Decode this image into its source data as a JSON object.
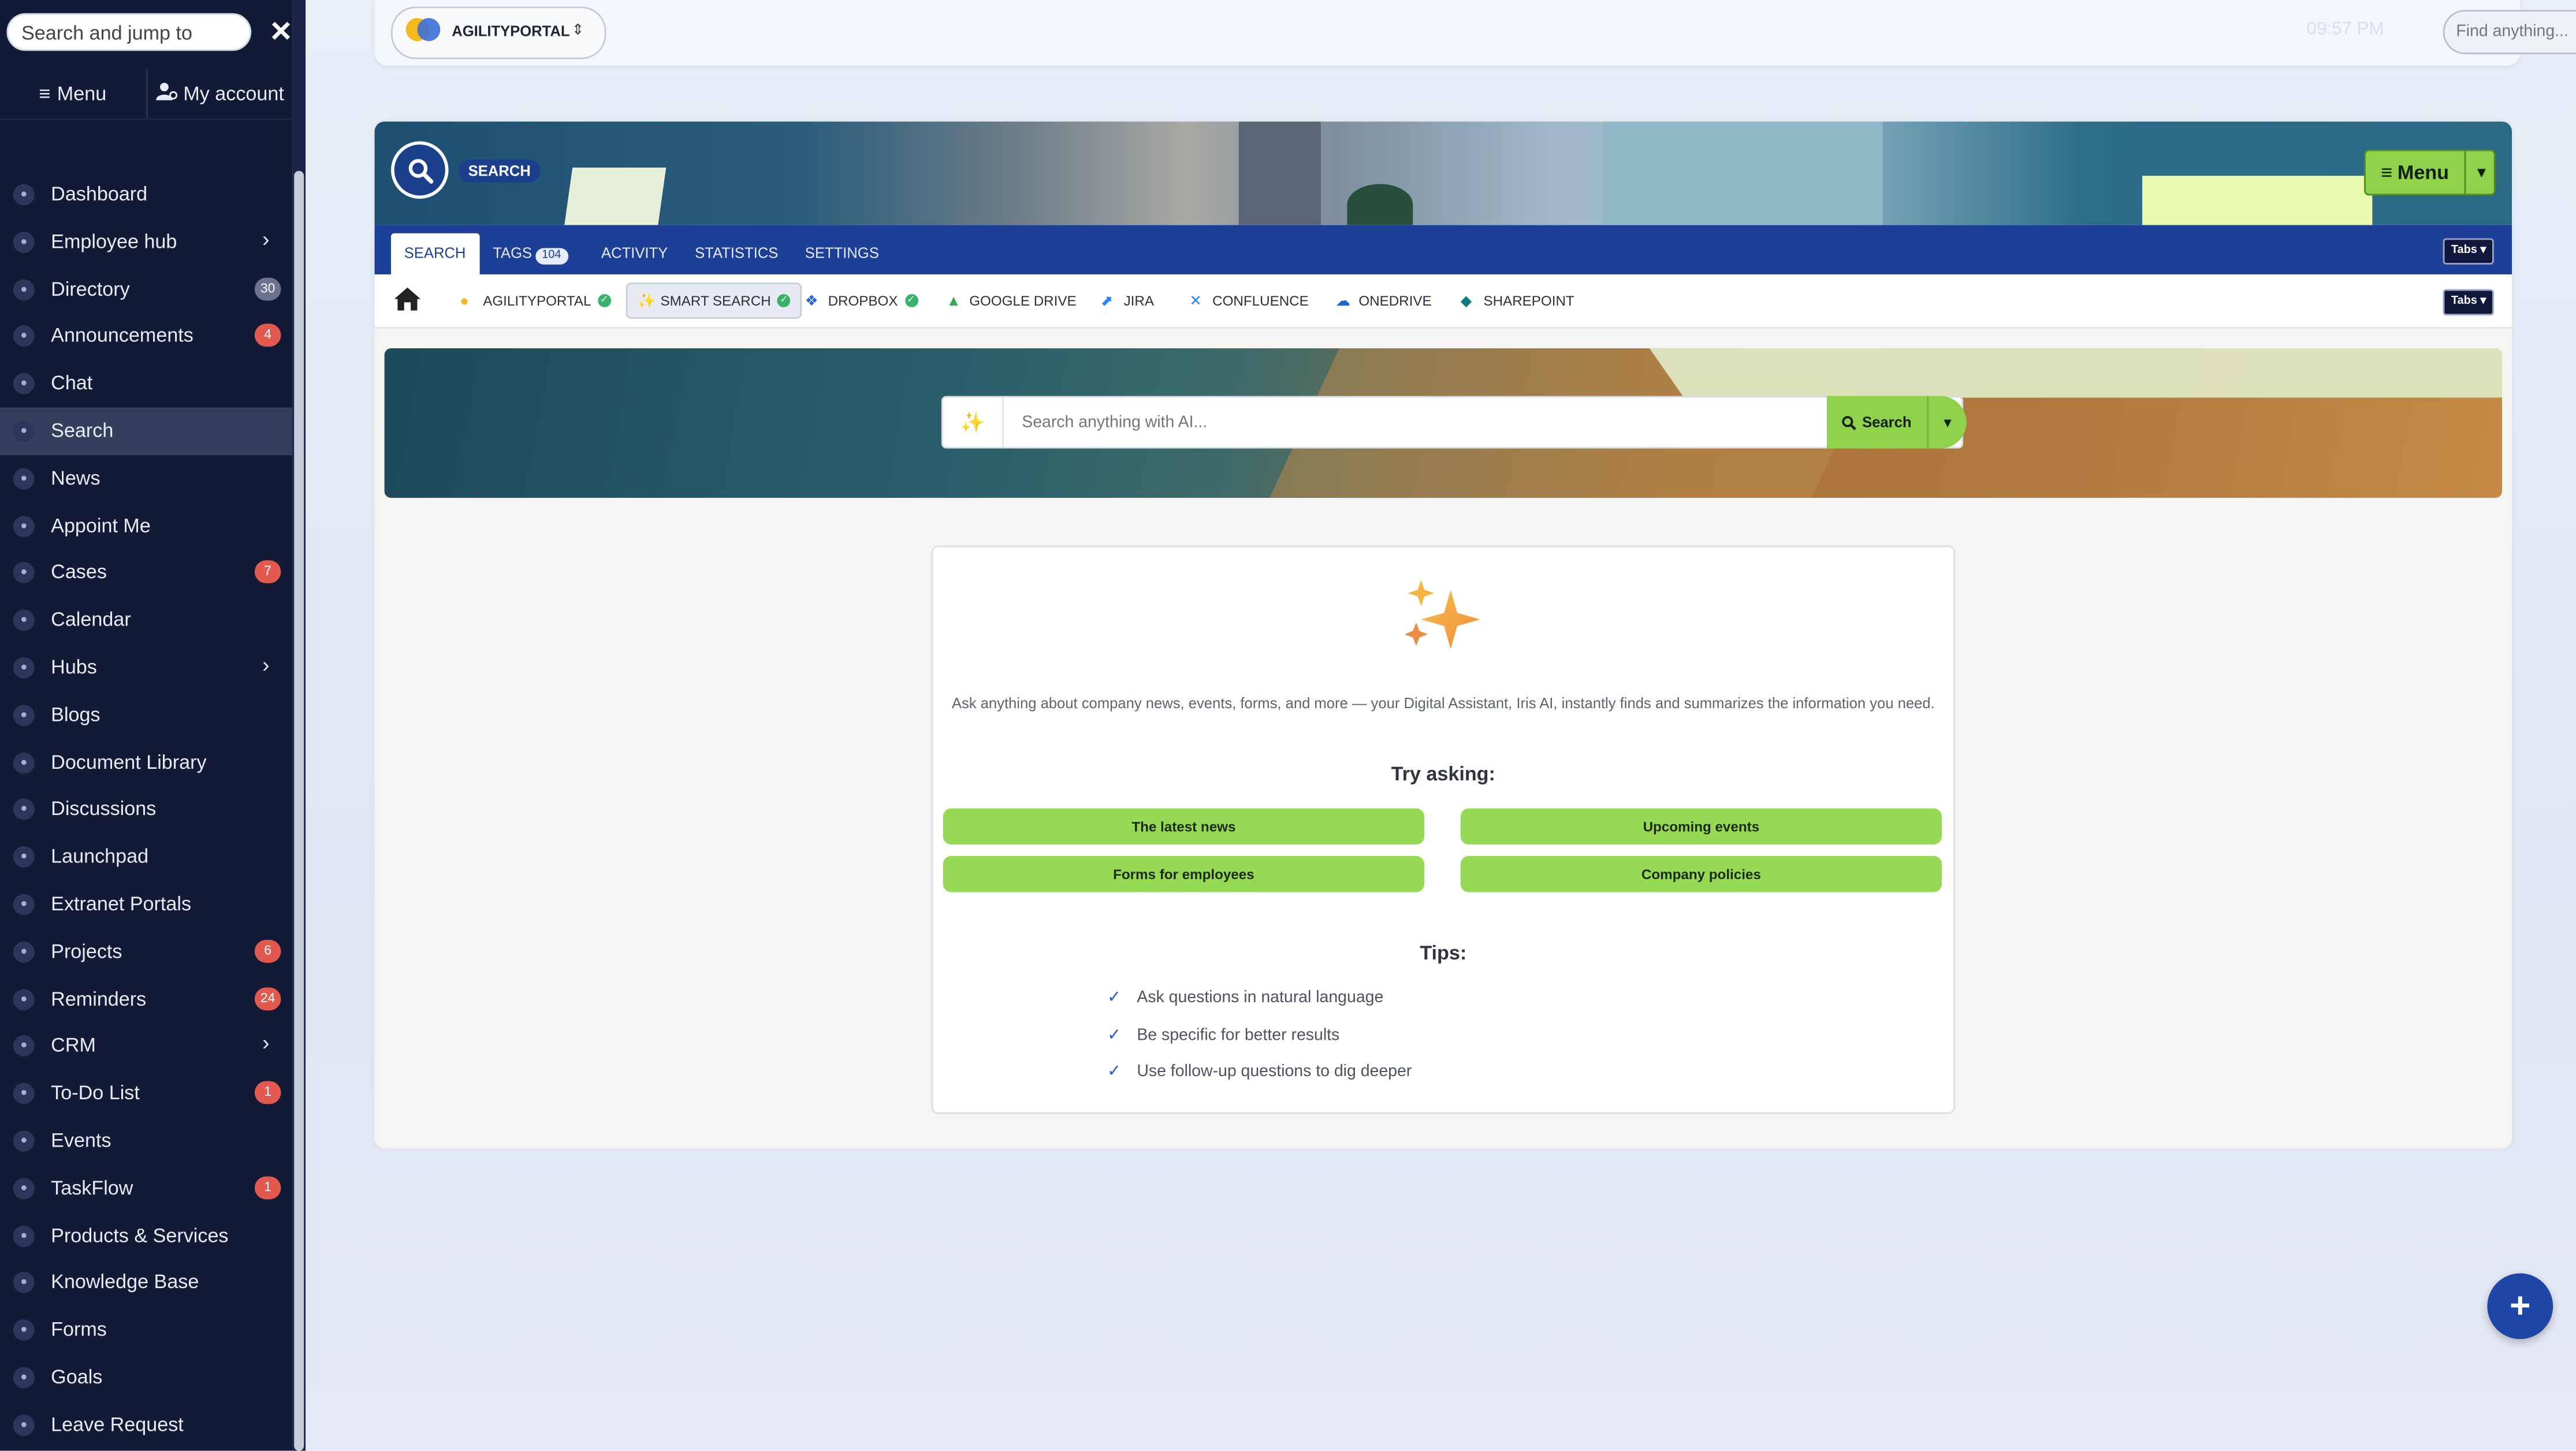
{
  "sidebar": {
    "search_placeholder": "Search and jump to",
    "menu_label": "Menu",
    "account_label": "My account",
    "items": [
      {
        "label": "Dashboard",
        "icon": "home-icon"
      },
      {
        "label": "Employee hub",
        "icon": "people-icon",
        "chevron": true
      },
      {
        "label": "Directory",
        "icon": "address-book-icon",
        "badge": "30",
        "badge_style": "grey"
      },
      {
        "label": "Announcements",
        "icon": "megaphone-icon",
        "badge": "4"
      },
      {
        "label": "Chat",
        "icon": "chat-icon"
      },
      {
        "label": "Search",
        "icon": "search-icon",
        "active": true
      },
      {
        "label": "News",
        "icon": "newspaper-icon"
      },
      {
        "label": "Appoint Me",
        "icon": "calendar-check-icon"
      },
      {
        "label": "Cases",
        "icon": "life-ring-icon",
        "badge": "7"
      },
      {
        "label": "Calendar",
        "icon": "calendar-icon"
      },
      {
        "label": "Hubs",
        "icon": "group-icon",
        "chevron": true
      },
      {
        "label": "Blogs",
        "icon": "blog-icon"
      },
      {
        "label": "Document Library",
        "icon": "folder-icon"
      },
      {
        "label": "Discussions",
        "icon": "comments-icon"
      },
      {
        "label": "Launchpad",
        "icon": "rocket-icon"
      },
      {
        "label": "Extranet Portals",
        "icon": "portal-icon"
      },
      {
        "label": "Projects",
        "icon": "project-diagram-icon",
        "badge": "6"
      },
      {
        "label": "Reminders",
        "icon": "stopwatch-icon",
        "badge": "24"
      },
      {
        "label": "CRM",
        "icon": "crm-icon",
        "chevron": true
      },
      {
        "label": "To-Do List",
        "icon": "list-icon",
        "badge": "1"
      },
      {
        "label": "Events",
        "icon": "event-icon"
      },
      {
        "label": "TaskFlow",
        "icon": "tasks-icon",
        "badge": "1"
      },
      {
        "label": "Products & Services",
        "icon": "box-icon"
      },
      {
        "label": "Knowledge Base",
        "icon": "book-icon"
      },
      {
        "label": "Forms",
        "icon": "form-icon"
      },
      {
        "label": "Goals",
        "icon": "target-icon"
      },
      {
        "label": "Leave Request",
        "icon": "plane-icon"
      }
    ]
  },
  "topbar": {
    "brand": "AGILITYPORTAL",
    "time_faded": "09:57 PM",
    "find_placeholder": "Find anything..."
  },
  "panel": {
    "label": "SEARCH",
    "menu_label": "Menu",
    "tabs": [
      {
        "label": "SEARCH",
        "active": true
      },
      {
        "label": "TAGS",
        "count": "104"
      },
      {
        "label": "ACTIVITY"
      },
      {
        "label": "STATISTICS"
      },
      {
        "label": "SETTINGS"
      }
    ],
    "tabs_dropdown": "Tabs",
    "sources": [
      {
        "label": "AGILITYPORTAL",
        "check": true
      },
      {
        "label": "SMART SEARCH",
        "check": true,
        "active": true
      },
      {
        "label": "DROPBOX",
        "check": true
      },
      {
        "label": "GOOGLE DRIVE"
      },
      {
        "label": "JIRA"
      },
      {
        "label": "CONFLUENCE"
      },
      {
        "label": "ONEDRIVE"
      },
      {
        "label": "SHAREPOINT"
      }
    ],
    "ai_placeholder": "Search anything with AI...",
    "search_button": "Search",
    "description": "Ask anything about company news, events, forms, and more — your Digital Assistant, Iris AI, instantly finds and summarizes the information you need.",
    "try_heading": "Try asking:",
    "suggestions": [
      "The latest news",
      "Upcoming events",
      "Forms for employees",
      "Company policies"
    ],
    "tips_heading": "Tips:",
    "tips": [
      "Ask questions in natural language",
      "Be specific for better results",
      "Use follow-up questions to dig deeper"
    ]
  },
  "colors": {
    "sidebar_bg": "#121a36",
    "tab_bar": "#1e3f98",
    "accent_green": "#8fd14a",
    "badge_red": "#e25a4f",
    "fab_blue": "#1e47a5"
  }
}
